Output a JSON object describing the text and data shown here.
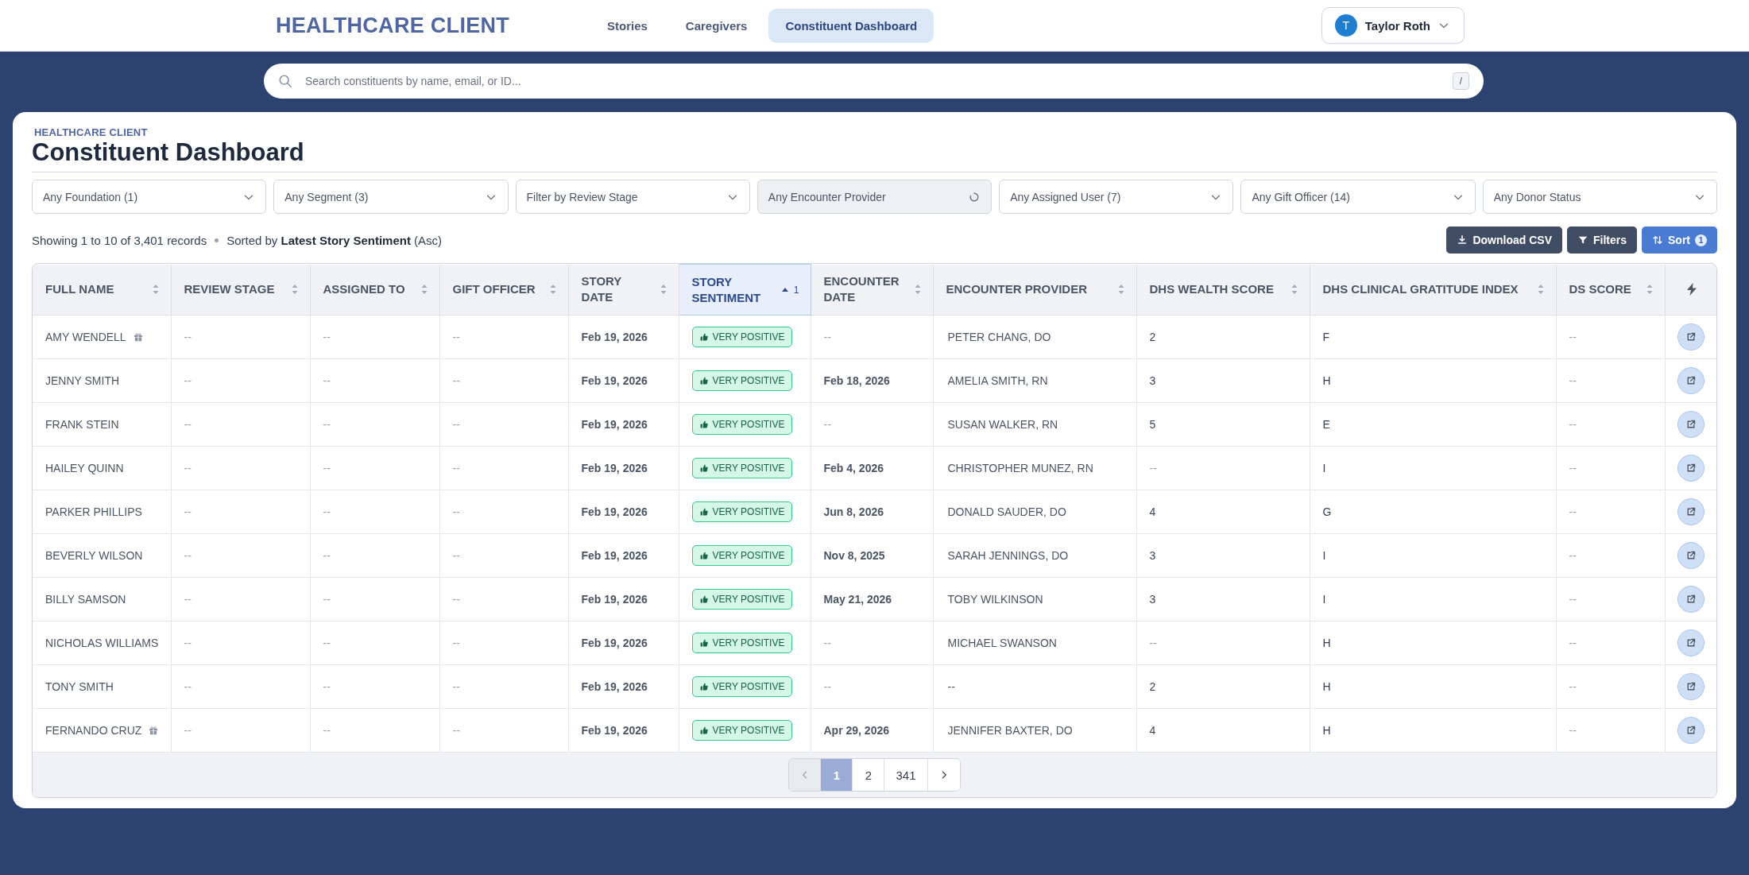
{
  "header": {
    "logo": "HEALTHCARE CLIENT",
    "nav": [
      {
        "label": "Stories",
        "selected": false
      },
      {
        "label": "Caregivers",
        "selected": false
      },
      {
        "label": "Constituent Dashboard",
        "selected": true
      }
    ],
    "user": {
      "initial": "T",
      "name": "Taylor Roth"
    }
  },
  "search": {
    "placeholder": "Search constituents by name, email, or ID...",
    "shortcut": "/"
  },
  "page": {
    "breadcrumb": "HEALTHCARE CLIENT",
    "title": "Constituent Dashboard"
  },
  "filters": [
    {
      "label": "Any Foundation (1)",
      "loading": false
    },
    {
      "label": "Any Segment (3)",
      "loading": false
    },
    {
      "label": "Filter by Review Stage",
      "loading": false
    },
    {
      "label": "Any Encounter Provider",
      "loading": true
    },
    {
      "label": "Any Assigned User (7)",
      "loading": false
    },
    {
      "label": "Any Gift Officer (14)",
      "loading": false
    },
    {
      "label": "Any Donor Status",
      "loading": false
    }
  ],
  "summary": {
    "records": "Showing 1 to 10 of 3,401 records",
    "sorted": "Sorted by **Latest Story Sentiment** (Asc)"
  },
  "actions": [
    {
      "kind": "download",
      "label": "Download CSV"
    },
    {
      "kind": "filter",
      "label": "Filters"
    },
    {
      "kind": "sort",
      "label": "Sort",
      "badge": "1"
    }
  ],
  "table": {
    "columns": [
      {
        "label": "FULL NAME",
        "kind": "text",
        "sorted": false
      },
      {
        "label": "REVIEW STAGE",
        "kind": "text",
        "sorted": false
      },
      {
        "label": "ASSIGNED TO",
        "kind": "text",
        "sorted": false
      },
      {
        "label": "GIFT OFFICER",
        "kind": "text",
        "sorted": false
      },
      {
        "label": "STORY DATE",
        "kind": "text",
        "sorted": false
      },
      {
        "label": "STORY SENTIMENT",
        "kind": "text",
        "sorted": true,
        "sort_rank": "1"
      },
      {
        "label": "ENCOUNTER DATE",
        "kind": "text",
        "sorted": false
      },
      {
        "label": "ENCOUNTER PROVIDER",
        "kind": "text",
        "sorted": false
      },
      {
        "label": "DHS WEALTH SCORE",
        "kind": "text",
        "sorted": false
      },
      {
        "label": "DHS CLINICAL GRATITUDE INDEX",
        "kind": "text",
        "sorted": false
      },
      {
        "label": "DS SCORE",
        "kind": "text",
        "sorted": false
      },
      {
        "kind": "action",
        "sorted": false
      }
    ],
    "rows": [
      {
        "name": "AMY WENDELL",
        "gift": true,
        "review_stage": "--",
        "assigned_to": "--",
        "gift_officer": "--",
        "story_date": "Feb 19, 2026",
        "sentiment": "VERY POSITIVE",
        "encounter_date": "--",
        "provider": "PETER CHANG, DO",
        "wealth": "2",
        "gratitude": "F",
        "ds_score": "--"
      },
      {
        "name": "JENNY SMITH",
        "gift": false,
        "review_stage": "--",
        "assigned_to": "--",
        "gift_officer": "--",
        "story_date": "Feb 19, 2026",
        "sentiment": "VERY POSITIVE",
        "encounter_date": "Feb 18, 2026",
        "provider": "AMELIA SMITH, RN",
        "wealth": "3",
        "gratitude": "H",
        "ds_score": "--"
      },
      {
        "name": "FRANK STEIN",
        "gift": false,
        "review_stage": "--",
        "assigned_to": "--",
        "gift_officer": "--",
        "story_date": "Feb 19, 2026",
        "sentiment": "VERY POSITIVE",
        "encounter_date": "--",
        "provider": "SUSAN WALKER, RN",
        "wealth": "5",
        "gratitude": "E",
        "ds_score": "--"
      },
      {
        "name": "HAILEY QUINN",
        "gift": false,
        "review_stage": "--",
        "assigned_to": "--",
        "gift_officer": "--",
        "story_date": "Feb 19, 2026",
        "sentiment": "VERY POSITIVE",
        "encounter_date": "Feb 4, 2026",
        "provider": "CHRISTOPHER MUNEZ, RN",
        "wealth": "--",
        "gratitude": "I",
        "ds_score": "--"
      },
      {
        "name": "PARKER PHILLIPS",
        "gift": false,
        "review_stage": "--",
        "assigned_to": "--",
        "gift_officer": "--",
        "story_date": "Feb 19, 2026",
        "sentiment": "VERY POSITIVE",
        "encounter_date": "Jun 8, 2026",
        "provider": "DONALD SAUDER, DO",
        "wealth": "4",
        "gratitude": "G",
        "ds_score": "--"
      },
      {
        "name": "BEVERLY WILSON",
        "gift": false,
        "review_stage": "--",
        "assigned_to": "--",
        "gift_officer": "--",
        "story_date": "Feb 19, 2026",
        "sentiment": "VERY POSITIVE",
        "encounter_date": "Nov 8, 2025",
        "provider": "SARAH JENNINGS, DO",
        "wealth": "3",
        "gratitude": "I",
        "ds_score": "--"
      },
      {
        "name": "BILLY SAMSON",
        "gift": false,
        "review_stage": "--",
        "assigned_to": "--",
        "gift_officer": "--",
        "story_date": "Feb 19, 2026",
        "sentiment": "VERY POSITIVE",
        "encounter_date": "May 21, 2026",
        "provider": "TOBY WILKINSON",
        "wealth": "3",
        "gratitude": "I",
        "ds_score": "--"
      },
      {
        "name": "NICHOLAS WILLIAMS",
        "gift": false,
        "review_stage": "--",
        "assigned_to": "--",
        "gift_officer": "--",
        "story_date": "Feb 19, 2026",
        "sentiment": "VERY POSITIVE",
        "encounter_date": "--",
        "provider": "MICHAEL SWANSON",
        "wealth": "--",
        "gratitude": "H",
        "ds_score": "--"
      },
      {
        "name": "TONY SMITH",
        "gift": false,
        "review_stage": "--",
        "assigned_to": "--",
        "gift_officer": "--",
        "story_date": "Feb 19, 2026",
        "sentiment": "VERY POSITIVE",
        "encounter_date": "--",
        "provider": "--",
        "wealth": "2",
        "gratitude": "H",
        "ds_score": "--"
      },
      {
        "name": "FERNANDO CRUZ",
        "gift": true,
        "review_stage": "--",
        "assigned_to": "--",
        "gift_officer": "--",
        "story_date": "Feb 19, 2026",
        "sentiment": "VERY POSITIVE",
        "encounter_date": "Apr 29, 2026",
        "provider": "JENNIFER BAXTER, DO",
        "wealth": "4",
        "gratitude": "H",
        "ds_score": "--"
      }
    ]
  },
  "pagination": {
    "prev_disabled": true,
    "next_disabled": false,
    "pages": [
      {
        "label": "1",
        "selected": true
      },
      {
        "label": "2",
        "selected": false
      },
      {
        "label": "341",
        "selected": false
      }
    ]
  }
}
